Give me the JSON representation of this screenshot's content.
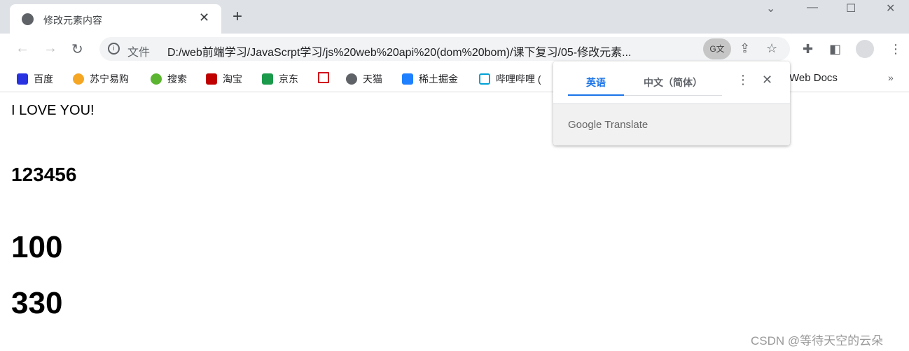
{
  "tab": {
    "title": "修改元素内容"
  },
  "omnibox": {
    "scheme": "文件",
    "url": "D:/web前端学习/JavaScrpt学习/js%20web%20api%20(dom%20bom)/课下复习/05-修改元素..."
  },
  "bookmarks": [
    {
      "label": "百度",
      "color": "#2932e1"
    },
    {
      "label": "苏宁易购",
      "color": "#f5a623"
    },
    {
      "label": "搜索",
      "color": "#5cb531"
    },
    {
      "label": "淘宝",
      "color": "#c00000"
    },
    {
      "label": "京东",
      "color": "#1a9a4a"
    },
    {
      "label": "",
      "color": "#d0021b"
    },
    {
      "label": "天猫",
      "color": "#5f6368"
    },
    {
      "label": "稀土掘金",
      "color": "#1e80ff"
    },
    {
      "label": "哔哩哔哩 (",
      "color": "#00a1d6"
    },
    {
      "label": "Web Docs",
      "color": ""
    }
  ],
  "content": {
    "line1": "I LOVE YOU!",
    "line2": "123456",
    "line3": "100",
    "line4": "330"
  },
  "translate_popup": {
    "tab_source": "英语",
    "tab_target": "中文（简体）",
    "footer": "Google Translate"
  },
  "watermark": "CSDN @等待天空的云朵"
}
